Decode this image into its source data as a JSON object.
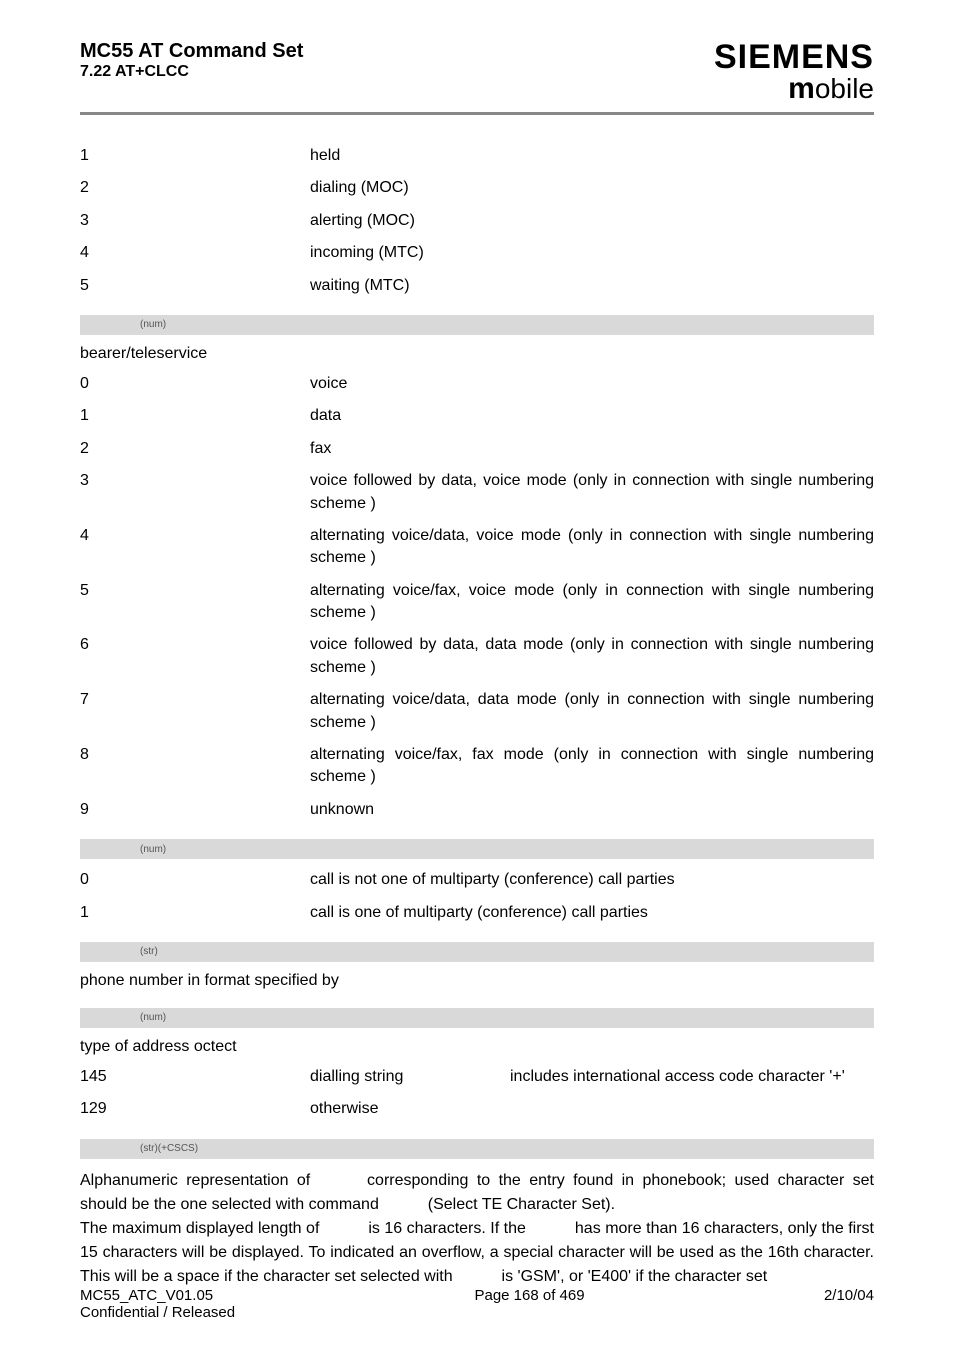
{
  "header": {
    "title": "MC55 AT Command Set",
    "subtitle": "7.22 AT+CLCC",
    "logo_top": "SIEMENS",
    "logo_bottom_m": "m",
    "logo_bottom_rest": "obile"
  },
  "stat_rows": [
    {
      "k": "1",
      "v": "held"
    },
    {
      "k": "2",
      "v": "dialing (MOC)"
    },
    {
      "k": "3",
      "v": "alerting (MOC)"
    },
    {
      "k": "4",
      "v": "incoming (MTC)"
    },
    {
      "k": "5",
      "v": "waiting (MTC)"
    }
  ],
  "bar1": "(num)",
  "bearer_label": "bearer/teleservice",
  "bearer_rows": [
    {
      "k": "0",
      "v": "voice"
    },
    {
      "k": "1",
      "v": "data"
    },
    {
      "k": "2",
      "v": "fax"
    },
    {
      "k": "3",
      "v": "voice followed by data, voice mode (only in connection with single numbering scheme             )"
    },
    {
      "k": "4",
      "v": "alternating voice/data, voice mode (only in connection with single numbering scheme             )"
    },
    {
      "k": "5",
      "v": "alternating voice/fax, voice mode (only in connection with single numbering scheme             )"
    },
    {
      "k": "6",
      "v": "voice followed by data, data mode (only in connection with single numbering scheme             )"
    },
    {
      "k": "7",
      "v": "alternating voice/data, data mode (only in connection with single numbering scheme             )"
    },
    {
      "k": "8",
      "v": "alternating voice/fax, fax mode (only in connection with single numbering scheme             )"
    },
    {
      "k": "9",
      "v": "unknown"
    }
  ],
  "bar2": "(num)",
  "mpty_rows": [
    {
      "k": "0",
      "v": "call is not one of multiparty (conference) call parties"
    },
    {
      "k": "1",
      "v": "call is one of multiparty (conference) call parties"
    }
  ],
  "bar3": "(str)",
  "phone_note": "phone number in format specified by",
  "bar4": "(num)",
  "type_label": "type of address octect",
  "type_rows": [
    {
      "k": "145",
      "c1": "dialling string",
      "c2": "includes international access code character '+'"
    },
    {
      "k": "129",
      "c1": "otherwise",
      "c2": ""
    }
  ],
  "bar5": "(str)(+CSCS)",
  "alpha": {
    "p1a": "Alphanumeric representation of ",
    "p1b": " corresponding to the entry found in phonebook; used character set should be the one selected with command ",
    "p1c": " (Select TE Character Set).",
    "p2a": "The maximum displayed length of ",
    "p2b": " is 16 characters. If the ",
    "p2c": " has more than 16 characters, only the first 15 characters will be displayed. To indicated an overflow, a special character will be used as the 16th character. This will be a space if the character set selected with ",
    "p2d": " is 'GSM', or 'E400' if the character set"
  },
  "footer": {
    "left1": "MC55_ATC_V01.05",
    "left2": "Confidential / Released",
    "center": "Page 168 of 469",
    "right": "2/10/04"
  }
}
